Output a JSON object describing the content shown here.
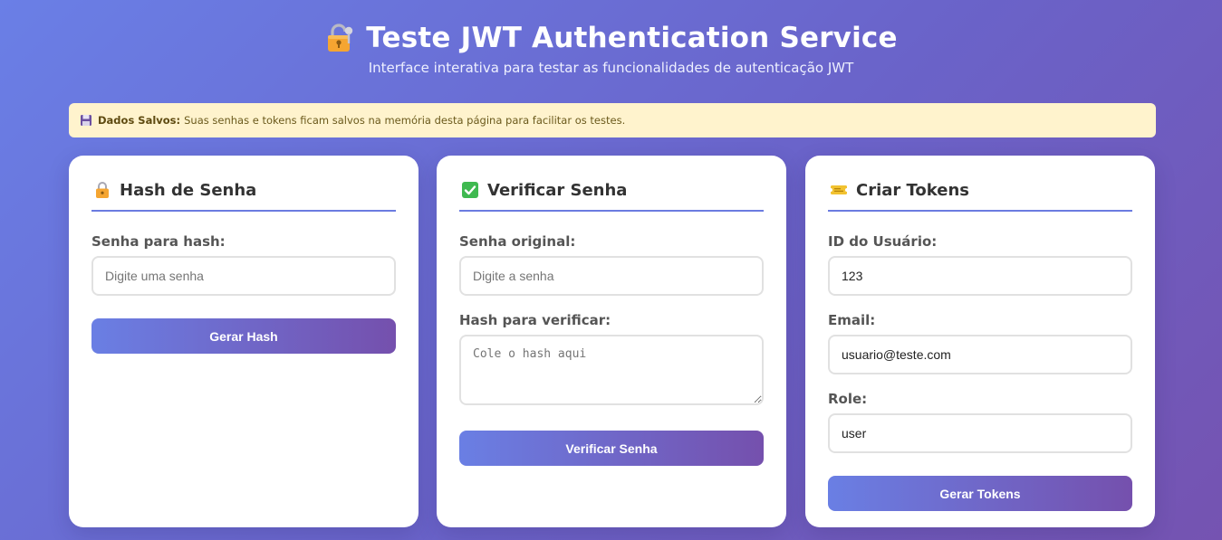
{
  "header": {
    "title": "Teste JWT Authentication Service",
    "subtitle": "Interface interativa para testar as funcionalidades de autenticação JWT"
  },
  "notice": {
    "label": "Dados Salvos:",
    "text": "Suas senhas e tokens ficam salvos na memória desta página para facilitar os testes."
  },
  "cards": {
    "hash": {
      "title": "Hash de Senha",
      "icon": "lock-icon",
      "password_label": "Senha para hash:",
      "password_placeholder": "Digite uma senha",
      "password_value": "",
      "button": "Gerar Hash"
    },
    "verify": {
      "title": "Verificar Senha",
      "icon": "check-icon",
      "password_label": "Senha original:",
      "password_placeholder": "Digite a senha",
      "password_value": "",
      "hash_label": "Hash para verificar:",
      "hash_placeholder": "Cole o hash aqui",
      "hash_value": "",
      "button": "Verificar Senha"
    },
    "tokens": {
      "title": "Criar Tokens",
      "icon": "ticket-icon",
      "user_id_label": "ID do Usuário:",
      "user_id_value": "123",
      "email_label": "Email:",
      "email_value": "usuario@teste.com",
      "role_label": "Role:",
      "role_value": "user",
      "button": "Gerar Tokens"
    }
  },
  "colors": {
    "accent": "#6b7be0",
    "notice_bg": "#fff3cd",
    "button_start": "#6a7fe4",
    "button_end": "#7550ad"
  }
}
